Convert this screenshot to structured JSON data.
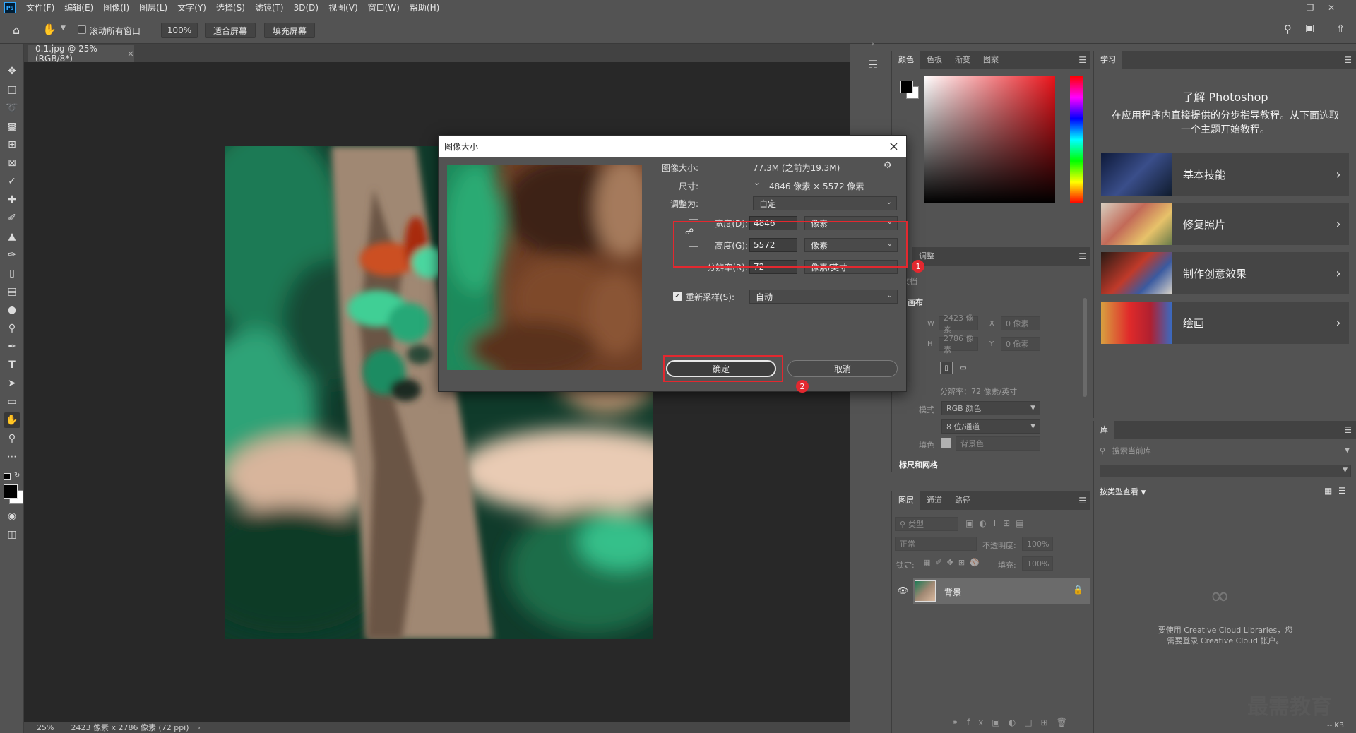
{
  "menubar": {
    "items": [
      "文件(F)",
      "编辑(E)",
      "图像(I)",
      "图层(L)",
      "文字(Y)",
      "选择(S)",
      "滤镜(T)",
      "3D(D)",
      "视图(V)",
      "窗口(W)",
      "帮助(H)"
    ],
    "logo": "Ps"
  },
  "options": {
    "scroll_all": "滚动所有窗口",
    "zoom": "100%",
    "fit_screen": "适合屏幕",
    "fill_screen": "填充屏幕"
  },
  "document": {
    "tab_title": "0.1.jpg @ 25%(RGB/8*)",
    "status_zoom": "25%",
    "status_info": "2423 像素 x 2786 像素 (72 ppi)"
  },
  "color_panel": {
    "tabs": [
      "颜色",
      "色板",
      "渐变",
      "图案"
    ]
  },
  "properties_panel": {
    "tabs": [
      "性",
      "调整"
    ],
    "doc_label": "文档",
    "canvas_title": "画布",
    "w_label": "W",
    "w_value": "2423 像素",
    "h_label": "H",
    "h_value": "2786 像素",
    "x_label": "X",
    "x_value": "0 像素",
    "y_label": "Y",
    "y_value": "0 像素",
    "resolution": "分辨率：72 像素/英寸",
    "mode_label": "模式",
    "mode_value": "RGB 颜色",
    "depth_value": "8 位/通道",
    "fill_label": "填色",
    "fill_value": "背景色",
    "rulers_title": "标尺和网格"
  },
  "layers_panel": {
    "tabs": [
      "图层",
      "通道",
      "路径"
    ],
    "search_placeholder": "类型",
    "blend_mode": "正常",
    "opacity_label": "不透明度:",
    "opacity_value": "100%",
    "lock_label": "锁定:",
    "fill_label": "填充:",
    "fill_value": "100%",
    "layer_name": "背景"
  },
  "learn_panel": {
    "tab": "学习",
    "title": "了解 Photoshop",
    "desc": "在应用程序内直接提供的分步指导教程。从下面选取一个主题开始教程。",
    "cards": [
      "基本技能",
      "修复照片",
      "制作创意效果",
      "绘画"
    ]
  },
  "library_panel": {
    "tab": "库",
    "search_placeholder": "搜索当前库",
    "view_by": "按类型查看",
    "cc_message_1": "要使用 Creative Cloud Libraries，您",
    "cc_message_2": "需要登录 Creative Cloud 帐户。",
    "kb": "-- KB"
  },
  "dialog": {
    "title": "图像大小",
    "image_size_label": "图像大小:",
    "image_size_value": "77.3M (之前为19.3M)",
    "dimension_label": "尺寸:",
    "dimension_value": "4846 像素 × 5572 像素",
    "fit_label": "调整为:",
    "fit_value": "自定",
    "width_label": "宽度(D):",
    "width_value": "4846",
    "width_unit": "像素",
    "height_label": "高度(G):",
    "height_value": "5572",
    "height_unit": "像素",
    "resolution_label": "分辨率(R):",
    "resolution_value": "72",
    "resolution_unit": "像素/英寸",
    "resample_label": "重新采样(S):",
    "resample_value": "自动",
    "ok": "确定",
    "cancel": "取消",
    "badge_1": "1",
    "badge_2": "2"
  },
  "watermark": "最需教育"
}
